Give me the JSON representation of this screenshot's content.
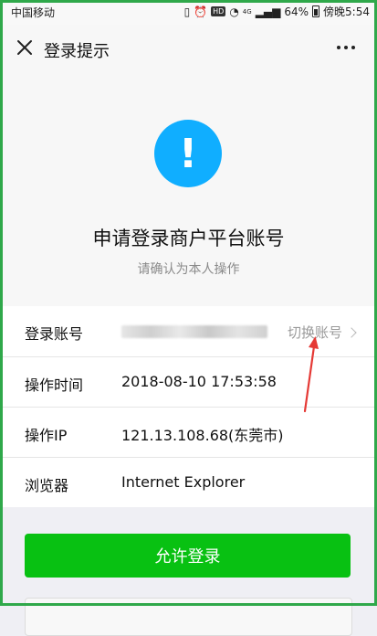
{
  "status": {
    "carrier": "中国移动",
    "battery": "64%",
    "time": "傍晚5:54",
    "hd": "HD",
    "net": "4G"
  },
  "nav": {
    "title": "登录提示"
  },
  "hero": {
    "title": "申请登录商户平台账号",
    "subtitle": "请确认为本人操作"
  },
  "details": {
    "account_label": "登录账号",
    "switch_label": "切换账号",
    "time_label": "操作时间",
    "time_value": "2018-08-10 17:53:58",
    "ip_label": "操作IP",
    "ip_value": "121.13.108.68(东莞市)",
    "browser_label": "浏览器",
    "browser_value": "Internet Explorer"
  },
  "actions": {
    "allow_label": "允许登录"
  },
  "colors": {
    "accent_green": "#08c112",
    "warning_blue": "#10aeff",
    "annotation_red": "#e53935"
  }
}
